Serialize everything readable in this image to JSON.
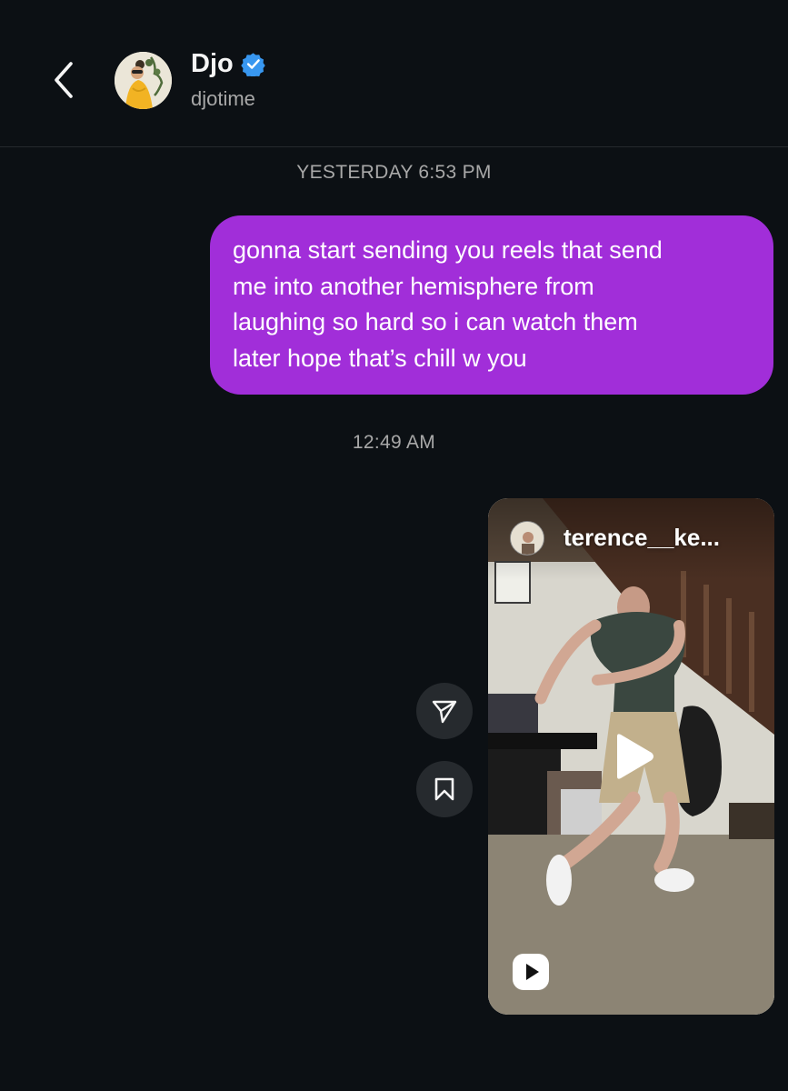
{
  "header": {
    "name": "Djo",
    "handle": "djotime",
    "verified": true,
    "back_icon": "chevron-left-icon",
    "verified_icon": "verified-badge-icon",
    "accent_color": "#3897f0"
  },
  "messages": [
    {
      "type": "timestamp",
      "text": "YESTERDAY 6:53 PM"
    },
    {
      "type": "text",
      "sender": "me",
      "lines": [
        "gonna start sending you reels that send",
        "me into another hemisphere from",
        "laughing so hard so i can watch them",
        "later hope that’s chill w you"
      ],
      "bubble_color": "#a12ed9"
    },
    {
      "type": "timestamp",
      "text": "12:49 AM"
    },
    {
      "type": "reel",
      "sender": "me",
      "author": "terence__ke...",
      "actions": [
        {
          "name": "share",
          "icon": "send-icon"
        },
        {
          "name": "save",
          "icon": "bookmark-icon"
        }
      ],
      "play_icon": "play-icon",
      "badge_icon": "reels-icon"
    }
  ],
  "colors": {
    "background": "#0c1014",
    "secondary_text": "#a8a8a8",
    "divider": "#262a2e"
  }
}
